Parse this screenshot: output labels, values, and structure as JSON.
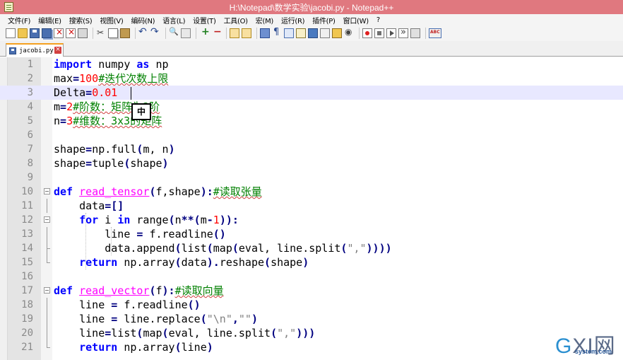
{
  "window": {
    "title": "H:\\Notepad\\数学实验\\jacobi.py - Notepad++"
  },
  "menu": [
    "文件(F)",
    "编辑(E)",
    "搜索(S)",
    "视图(V)",
    "编码(N)",
    "语言(L)",
    "设置(T)",
    "工具(O)",
    "宏(M)",
    "运行(R)",
    "插件(P)",
    "窗口(W)",
    "?"
  ],
  "toolbar": [
    "new-file-icon",
    "open-folder-icon",
    "save-icon",
    "save-all-icon",
    "close-file-icon",
    "close-all-icon",
    "print-icon",
    "cut-icon",
    "copy-icon",
    "paste-icon",
    "undo-icon",
    "redo-icon",
    "find-icon",
    "replace-icon",
    "zoom-in-icon",
    "zoom-out-icon",
    "sync-scroll-icon",
    "sync-h-icon",
    "word-wrap-icon",
    "show-all-chars-icon",
    "indent-guide-icon",
    "user-defined-language-icon",
    "document-map-icon",
    "function-list-icon",
    "folder-as-workspace-icon",
    "monitoring-icon",
    "record-macro-icon",
    "stop-macro-icon",
    "play-macro-icon",
    "run-macro-multiple-icon",
    "save-macro-icon",
    "spell-check-icon"
  ],
  "tab": {
    "label": "jacobi.py"
  },
  "editor": {
    "current_line": 3,
    "lines": [
      {
        "n": "1"
      },
      {
        "n": "2"
      },
      {
        "n": "3"
      },
      {
        "n": "4"
      },
      {
        "n": "5"
      },
      {
        "n": "6"
      },
      {
        "n": "7"
      },
      {
        "n": "8"
      },
      {
        "n": "9"
      },
      {
        "n": "10"
      },
      {
        "n": "11"
      },
      {
        "n": "12"
      },
      {
        "n": "13"
      },
      {
        "n": "14"
      },
      {
        "n": "15"
      },
      {
        "n": "16"
      },
      {
        "n": "17"
      },
      {
        "n": "18"
      },
      {
        "n": "19"
      },
      {
        "n": "20"
      },
      {
        "n": "21"
      }
    ],
    "code": {
      "l1": {
        "kw1": "import",
        "t1": " numpy ",
        "kw2": "as",
        "t2": " np"
      },
      "l2": {
        "t1": "max",
        "op1": "=",
        "num1": "100",
        "cm": "#迭代次数上限"
      },
      "l3": {
        "t1": "Delta",
        "op1": "=",
        "num1": "0.01"
      },
      "l4": {
        "t1": "m",
        "op1": "=",
        "num1": "2",
        "cm": "#阶数：矩阵为2阶"
      },
      "l5": {
        "t1": "n",
        "op1": "=",
        "num1": "3",
        "cm": "#维数：3x3的矩阵"
      },
      "l7": {
        "t1": "shape",
        "op1": "=",
        "t2": "np.full",
        "op2": "(",
        "t3": "m, n",
        "op3": ")"
      },
      "l8": {
        "t1": "shape",
        "op1": "=",
        "t2": "tuple",
        "op2": "(",
        "t3": "shape",
        "op3": ")"
      },
      "l10": {
        "kw1": "def",
        "t0": " ",
        "fn": "read_tensor",
        "op1": "(",
        "t1": "f,shape",
        "op2": "):",
        "cm": "#读取张量"
      },
      "l11": {
        "t1": "    data",
        "op1": "=[]"
      },
      "l12": {
        "kw1": "for",
        "t1": " i ",
        "kw2": "in",
        "t2": " range",
        "op1": "(",
        "t3": "n",
        "op2": "**(",
        "t4": "m",
        "op3": "-",
        "num1": "1",
        "op4": ")):"
      },
      "l13": {
        "t1": "        line ",
        "op1": "=",
        "t2": " f.readline",
        "op3": "()"
      },
      "l14": {
        "t1": "        data.append",
        "op1": "(",
        "t2": "list",
        "op2": "(",
        "t3": "map",
        "op3": "(",
        "t4": "eval, line.split",
        "op4": "(",
        "str": "\",\"",
        "op5": "))))"
      },
      "l15": {
        "kw1": "return",
        "t1": " np.array",
        "op1": "(",
        "t2": "data",
        "op2": ").",
        "t3": "reshape",
        "op3": "(",
        "t4": "shape",
        "op4": ")"
      },
      "l17": {
        "kw1": "def",
        "t0": " ",
        "fn": "read_vector",
        "op1": "(",
        "t1": "f",
        "op2": "):",
        "cm": "#读取向量"
      },
      "l18": {
        "t1": "    line ",
        "op1": "=",
        "t2": " f.readline",
        "op3": "()"
      },
      "l19": {
        "t1": "    line ",
        "op1": "=",
        "t2": " line.replace",
        "op2": "(",
        "str1": "\"\\n\"",
        "op3": ",",
        "str2": "\"\"",
        "op4": ")"
      },
      "l20": {
        "t1": "    line",
        "op1": "=",
        "t2": "list",
        "op2": "(",
        "t3": "map",
        "op3": "(",
        "t4": "eval, line.split",
        "op4": "(",
        "str": "\",\"",
        "op5": ")))"
      },
      "l21": {
        "kw1": "return",
        "t1": " np.array",
        "op1": "(",
        "t2": "line",
        "op2": ")"
      }
    }
  },
  "ime": {
    "label": "中"
  },
  "watermark": {
    "main": "GXI网",
    "sub": "system.com"
  },
  "colors": {
    "keyword": "#0000ff",
    "number": "#ff0000",
    "comment": "#008000",
    "string": "#808080",
    "function_name": "#ff00ff",
    "operator": "#000080",
    "titlebar": "#e0787f",
    "current_line": "#e8e8ff"
  }
}
